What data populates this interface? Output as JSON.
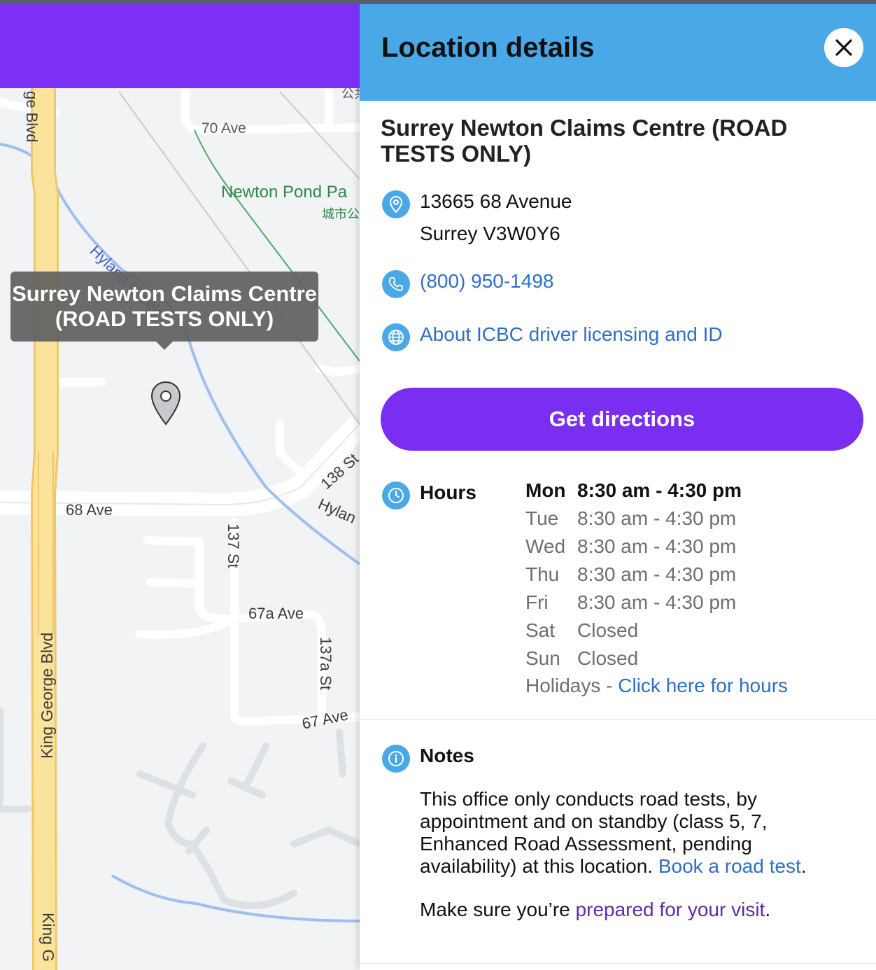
{
  "panel": {
    "title": "Location details",
    "location_name": "Surrey Newton Claims Centre (ROAD TESTS ONLY)",
    "address_line1": "13665 68 Avenue",
    "address_line2": "Surrey V3W0Y6",
    "phone": "(800) 950-1498",
    "about_link": "About ICBC driver licensing and ID",
    "directions_button": "Get directions",
    "hours_label": "Hours",
    "hours": [
      {
        "day": "Mon",
        "time": "8:30 am - 4:30 pm"
      },
      {
        "day": "Tue",
        "time": "8:30 am - 4:30 pm"
      },
      {
        "day": "Wed",
        "time": "8:30 am - 4:30 pm"
      },
      {
        "day": "Thu",
        "time": "8:30 am - 4:30 pm"
      },
      {
        "day": "Fri",
        "time": "8:30 am - 4:30 pm"
      },
      {
        "day": "Sat",
        "time": "Closed"
      },
      {
        "day": "Sun",
        "time": "Closed"
      }
    ],
    "holidays_prefix": "Holidays - ",
    "holidays_link": "Click here for hours",
    "notes_label": "Notes",
    "notes_text": "This office only conducts road tests, by appointment and on standby (class 5, 7, Enhanced Road Assessment, pending availability) at this location. ",
    "notes_link": "Book a road test",
    "notes_period": ".",
    "notes2_prefix": "Make sure you’re ",
    "notes2_link": "prepared for your visit",
    "notes2_period": "."
  },
  "map": {
    "tooltip": "Surrey Newton Claims Centre (ROAD TESTS ONLY)",
    "labels": {
      "king_george_top": "ge Blvd",
      "seventy_ave": "70 Ave",
      "newton_pond": "Newton Pond Pa",
      "newton_pond_cn": "城市公",
      "top_cn": "公共",
      "hyland_creek": "Hyland Creek",
      "sixty_eight_ave": "68 Ave",
      "one_thirty_eight": "138 St",
      "hyland_short": "Hylan",
      "one_thirty_seven": "137 St",
      "sixty_seven_a": "67a Ave",
      "one_thirty_seven_a": "137a St",
      "sixty_seven": "67 Ave",
      "king_george_main": "King George Blvd",
      "king_george_bottom": "King G"
    }
  },
  "colors": {
    "brand_purple": "#7a2ef2",
    "header_blue": "#4aa8e6",
    "link_blue": "#2f6fc5",
    "link_purple": "#5a2ea6"
  },
  "icons": [
    "close-icon",
    "location-pin-icon",
    "phone-icon",
    "globe-icon",
    "clock-icon",
    "info-icon",
    "map-marker-icon"
  ]
}
